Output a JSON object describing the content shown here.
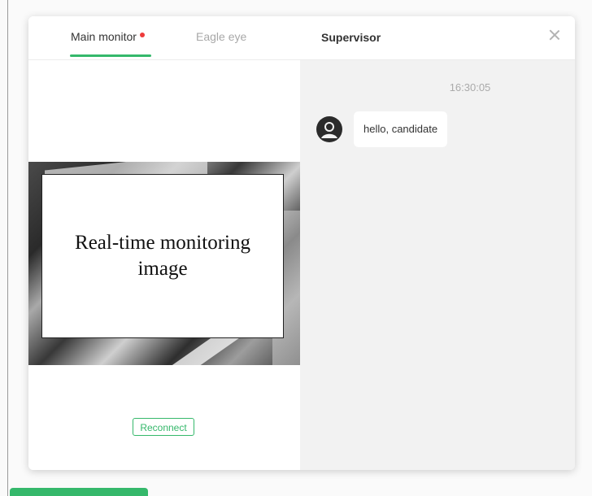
{
  "tabs": {
    "main_monitor": "Main monitor",
    "eagle_eye": "Eagle eye"
  },
  "video": {
    "overlay_text": "Real-time monitoring image"
  },
  "buttons": {
    "reconnect": "Reconnect"
  },
  "chat": {
    "title": "Supervisor",
    "timestamp": "16:30:05",
    "messages": [
      {
        "text": "hello, candidate"
      }
    ]
  },
  "colors": {
    "accent_green": "#35b86b",
    "live_dot_red": "#ee3b3b",
    "chat_background": "#f2f2f2"
  },
  "icons": {
    "close": "close-icon",
    "avatar": "user-avatar-icon",
    "live": "red-dot-icon"
  }
}
